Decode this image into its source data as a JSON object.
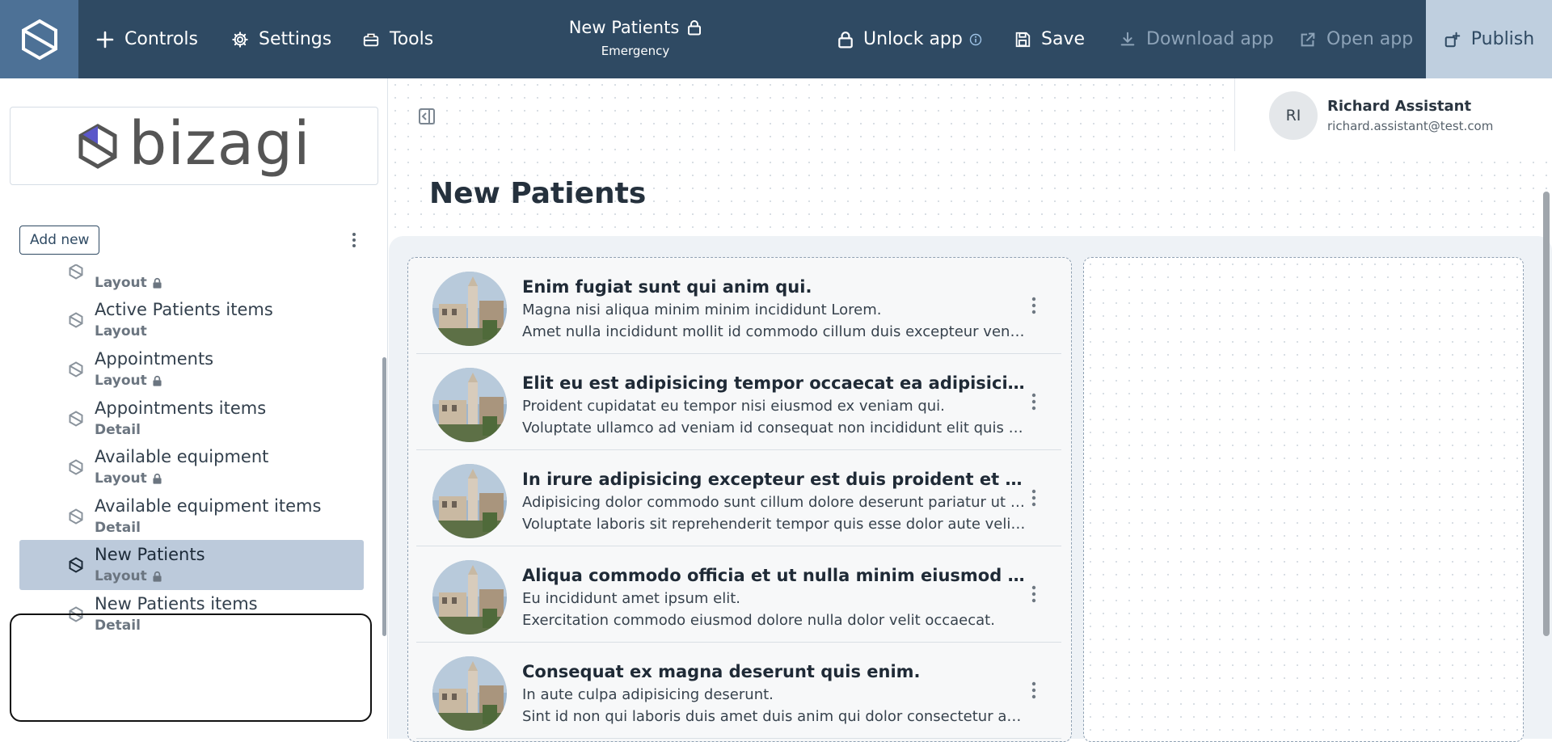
{
  "topbar": {
    "controls_label": "Controls",
    "settings_label": "Settings",
    "tools_label": "Tools",
    "page_name": "New Patients",
    "page_subtitle": "Emergency",
    "unlock_label": "Unlock app",
    "save_label": "Save",
    "download_label": "Download app",
    "open_label": "Open app",
    "publish_label": "Publish"
  },
  "sidebar": {
    "brand_name": "bizagi",
    "add_new_label": "Add new",
    "items": [
      {
        "label": "",
        "sub": "Layout",
        "locked": true,
        "selected": false
      },
      {
        "label": "Active Patients items",
        "sub": "Layout",
        "locked": false,
        "selected": false
      },
      {
        "label": "Appointments",
        "sub": "Layout",
        "locked": true,
        "selected": false
      },
      {
        "label": "Appointments items",
        "sub": "Detail",
        "locked": false,
        "selected": false
      },
      {
        "label": "Available equipment",
        "sub": "Layout",
        "locked": true,
        "selected": false
      },
      {
        "label": "Available equipment items",
        "sub": "Detail",
        "locked": false,
        "selected": false
      },
      {
        "label": "New Patients",
        "sub": "Layout",
        "locked": true,
        "selected": true
      },
      {
        "label": "New Patients items",
        "sub": "Detail",
        "locked": false,
        "selected": false
      }
    ]
  },
  "user": {
    "initials": "RI",
    "name": "Richard Assistant",
    "email": "richard.assistant@test.com"
  },
  "main": {
    "page_title": "New Patients",
    "rows": [
      {
        "title": "Enim fugiat sunt qui anim qui.",
        "line1": "Magna nisi aliqua minim minim incididunt Lorem.",
        "line2": "Amet nulla incididunt mollit id commodo cillum duis excepteur veniam."
      },
      {
        "title": "Elit eu est adipisicing tempor occaecat ea adipisicing commodo.",
        "line1": "Proident cupidatat eu tempor nisi eiusmod ex veniam qui.",
        "line2": "Voluptate ullamco ad veniam id consequat non incididunt elit quis nulla."
      },
      {
        "title": "In irure adipisicing excepteur est duis proident et duis.",
        "line1": "Adipisicing dolor commodo sunt cillum dolore deserunt pariatur ut esse.",
        "line2": "Voluptate laboris sit reprehenderit tempor quis esse dolor aute velit ea."
      },
      {
        "title": "Aliqua commodo officia et ut nulla minim eiusmod enim.",
        "line1": "Eu incididunt amet ipsum elit.",
        "line2": "Exercitation commodo eiusmod dolore nulla dolor velit occaecat."
      },
      {
        "title": "Consequat ex magna deserunt quis enim.",
        "line1": "In aute culpa adipisicing deserunt.",
        "line2": "Sint id non qui laboris duis amet duis anim qui dolor consectetur aute."
      }
    ]
  },
  "colors": {
    "topbar": "#2f4a63",
    "logo_tile": "#4d7196",
    "publish_bg": "#bfcfdf",
    "selected_item": "#bccadb"
  }
}
